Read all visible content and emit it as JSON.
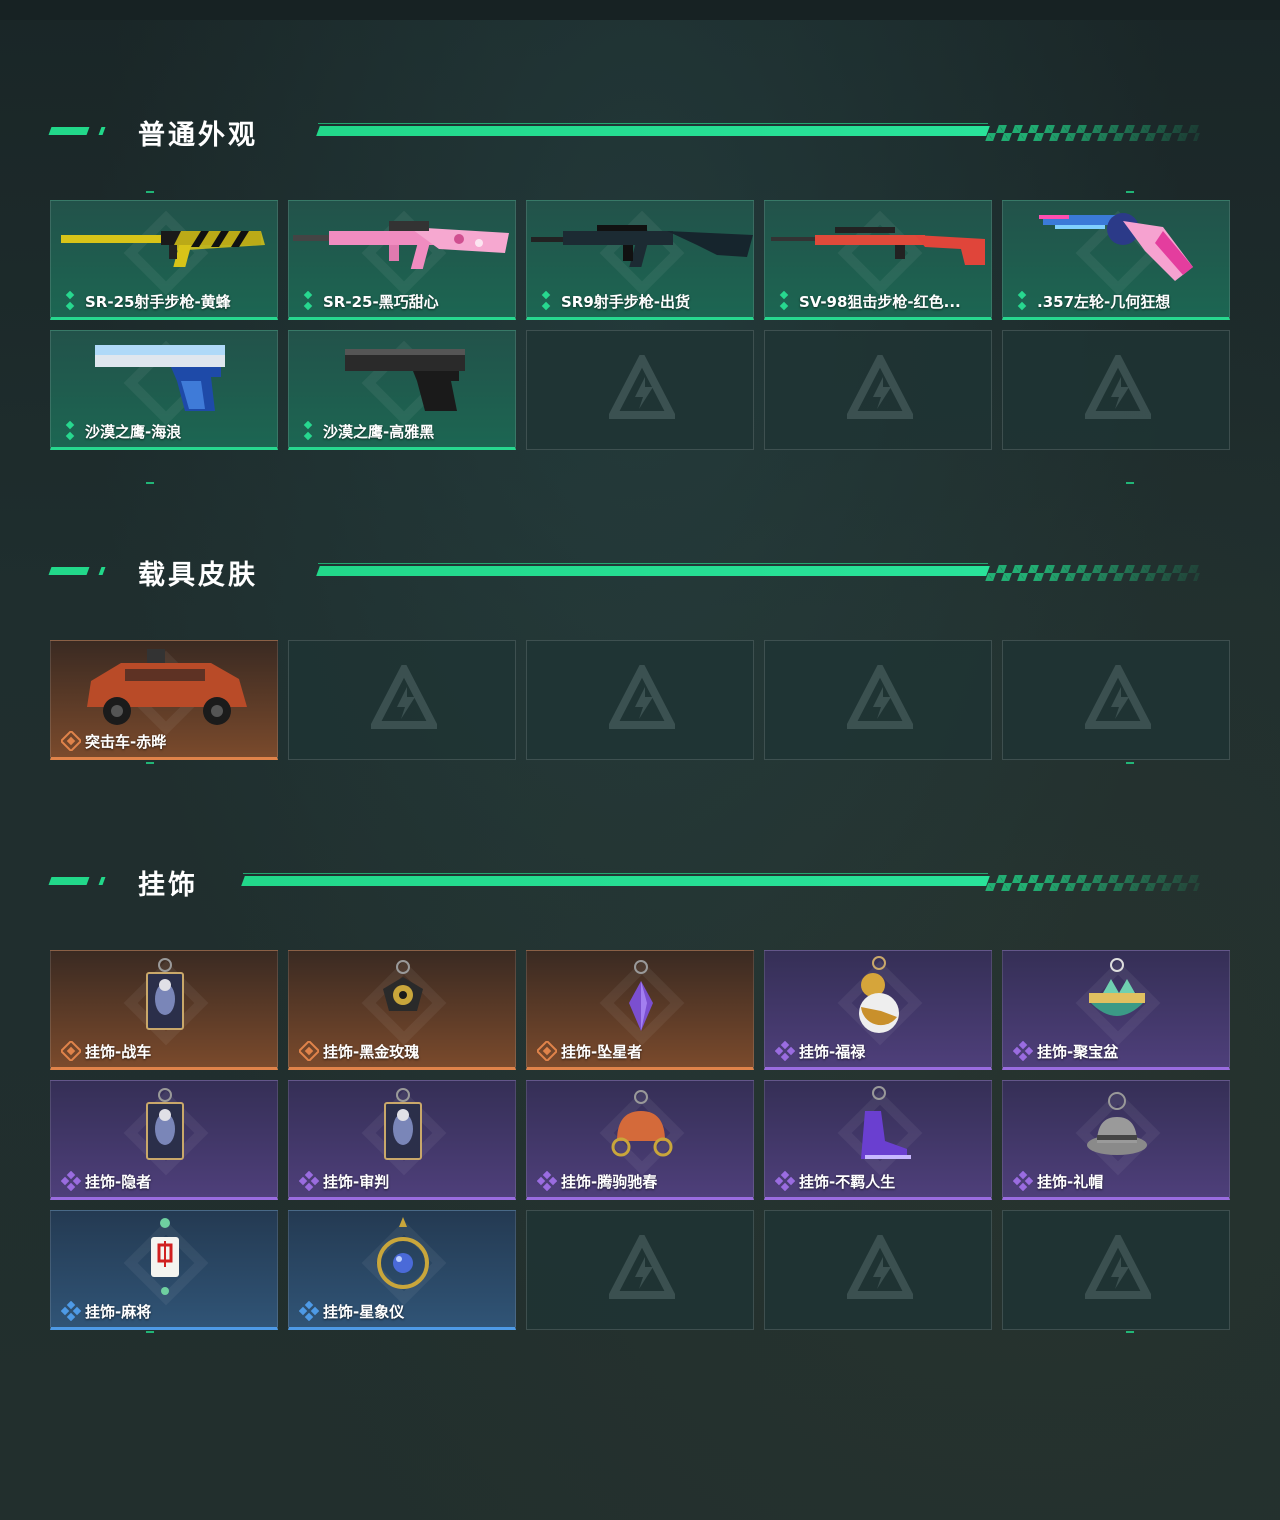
{
  "sections": [
    {
      "title": "普通外观",
      "items": [
        {
          "label": "SR-25射手步枪-黄蜂",
          "rarity": "green",
          "icon": "rifle-yellow-black"
        },
        {
          "label": "SR-25-黑巧甜心",
          "rarity": "green",
          "icon": "rifle-pink-camo"
        },
        {
          "label": "SR9射手步枪-出货",
          "rarity": "green",
          "icon": "rifle-dark-teal"
        },
        {
          "label": "SV-98狙击步枪-红色...",
          "rarity": "green",
          "icon": "sniper-red"
        },
        {
          "label": ".357左轮-几何狂想",
          "rarity": "green",
          "icon": "revolver-pink-blue"
        },
        {
          "label": "沙漠之鹰-海浪",
          "rarity": "green",
          "icon": "pistol-blue-wave"
        },
        {
          "label": "沙漠之鹰-高雅黑",
          "rarity": "green",
          "icon": "pistol-black"
        },
        {
          "label": "",
          "rarity": "empty"
        },
        {
          "label": "",
          "rarity": "empty"
        },
        {
          "label": "",
          "rarity": "empty"
        }
      ]
    },
    {
      "title": "载具皮肤",
      "items": [
        {
          "label": "突击车-赤晔",
          "rarity": "orange",
          "icon": "armored-car"
        },
        {
          "label": "",
          "rarity": "empty"
        },
        {
          "label": "",
          "rarity": "empty"
        },
        {
          "label": "",
          "rarity": "empty"
        },
        {
          "label": "",
          "rarity": "empty"
        }
      ]
    },
    {
      "title": "挂饰",
      "items": [
        {
          "label": "挂饰-战车",
          "rarity": "orange",
          "icon": "tarot-charm"
        },
        {
          "label": "挂饰-黑金玫瑰",
          "rarity": "orange",
          "icon": "rose-charm"
        },
        {
          "label": "挂饰-坠星者",
          "rarity": "orange",
          "icon": "crystal-charm"
        },
        {
          "label": "挂饰-福禄",
          "rarity": "purple",
          "icon": "gourd-charm"
        },
        {
          "label": "挂饰-聚宝盆",
          "rarity": "purple",
          "icon": "treasure-bowl-charm"
        },
        {
          "label": "挂饰-隐者",
          "rarity": "purple",
          "icon": "tarot-charm"
        },
        {
          "label": "挂饰-审判",
          "rarity": "purple",
          "icon": "tarot-charm"
        },
        {
          "label": "挂饰-腾驹驰春",
          "rarity": "purple",
          "icon": "carriage-charm"
        },
        {
          "label": "挂饰-不羁人生",
          "rarity": "purple",
          "icon": "sneaker-charm"
        },
        {
          "label": "挂饰-礼帽",
          "rarity": "purple",
          "icon": "hat-charm"
        },
        {
          "label": "挂饰-麻将",
          "rarity": "blue",
          "icon": "mahjong-charm"
        },
        {
          "label": "挂饰-星象仪",
          "rarity": "blue",
          "icon": "astrolabe-charm"
        },
        {
          "label": "",
          "rarity": "empty"
        },
        {
          "label": "",
          "rarity": "empty"
        },
        {
          "label": "",
          "rarity": "empty"
        }
      ]
    }
  ],
  "colors": {
    "accent": "#22d88a",
    "green": "#27d88f",
    "orange": "#e0834a",
    "purple": "#9a6ce0",
    "blue": "#4e9ae6"
  }
}
